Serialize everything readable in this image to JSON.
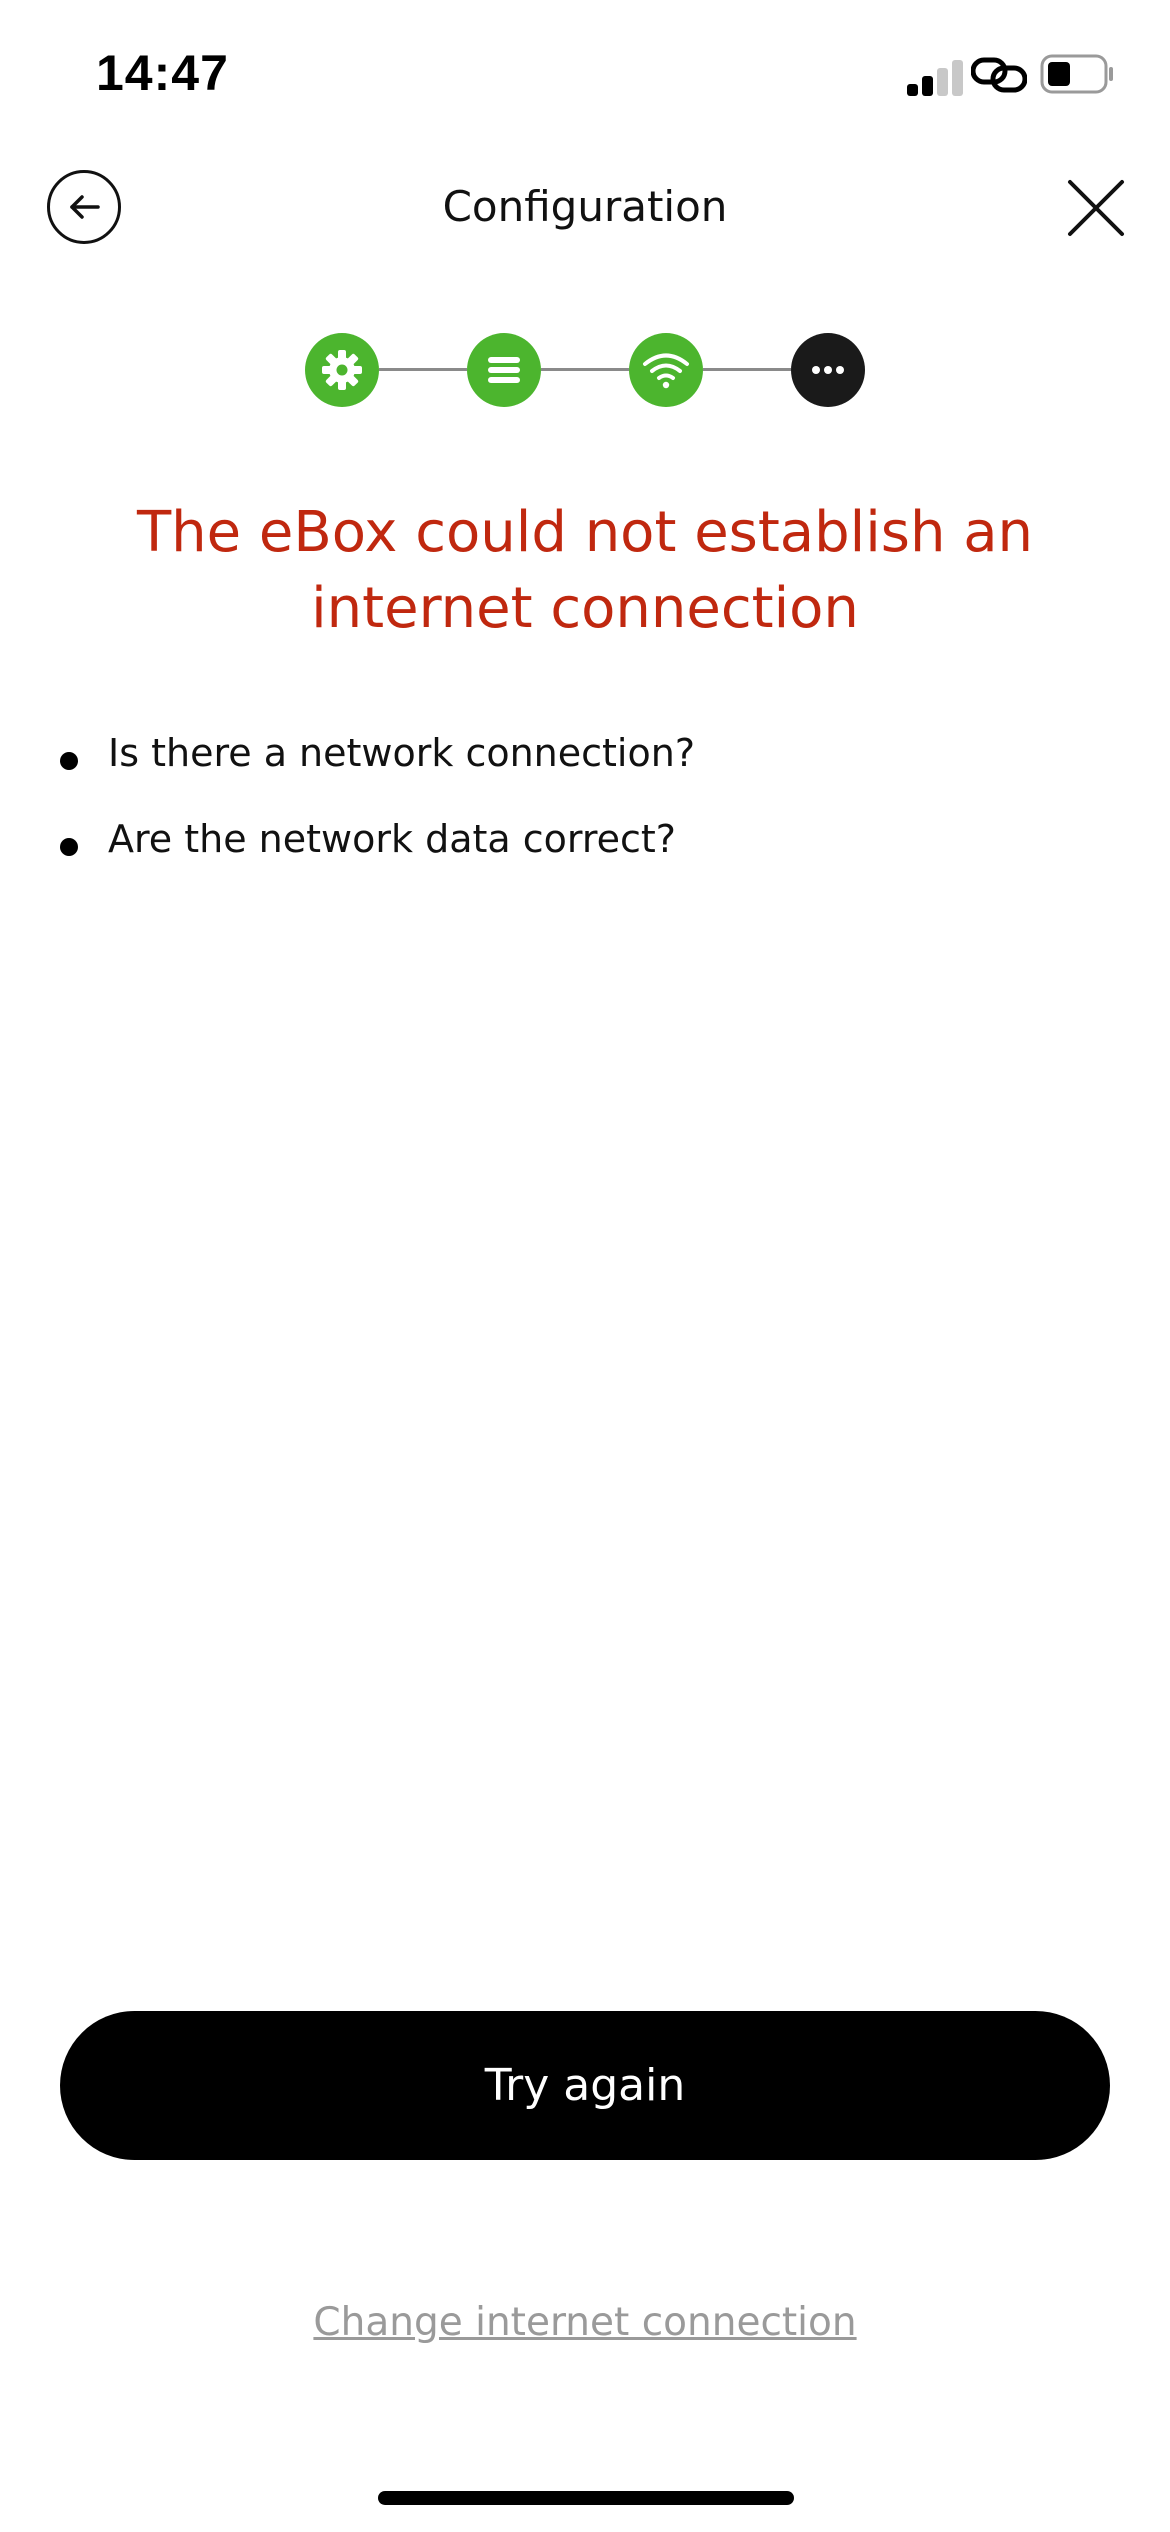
{
  "status_bar": {
    "time": "14:47",
    "icons": [
      "signal-icon",
      "link-icon",
      "battery-icon"
    ]
  },
  "nav": {
    "title": "Configuration",
    "back_icon": "arrow-left-icon",
    "close_icon": "close-icon"
  },
  "stepper": {
    "steps": [
      {
        "icon": "gear-icon",
        "status": "complete"
      },
      {
        "icon": "list-icon",
        "status": "complete"
      },
      {
        "icon": "wifi-icon",
        "status": "complete"
      },
      {
        "icon": "more-dots-icon",
        "status": "current"
      }
    ]
  },
  "error": {
    "title_line1": "The eBox could not establish an",
    "title_line2": "internet connection"
  },
  "checklist": {
    "items": [
      "Is there a network connection?",
      "Are the network data correct?"
    ]
  },
  "actions": {
    "try_again_label": "Try again",
    "change_connection_label": "Change internet connection"
  },
  "colors": {
    "accent_green": "#4cb52e",
    "error_red": "#c0280f",
    "primary_button": "#000000",
    "link_gray": "#9a9a9a",
    "current_step": "#1a1a1a"
  }
}
